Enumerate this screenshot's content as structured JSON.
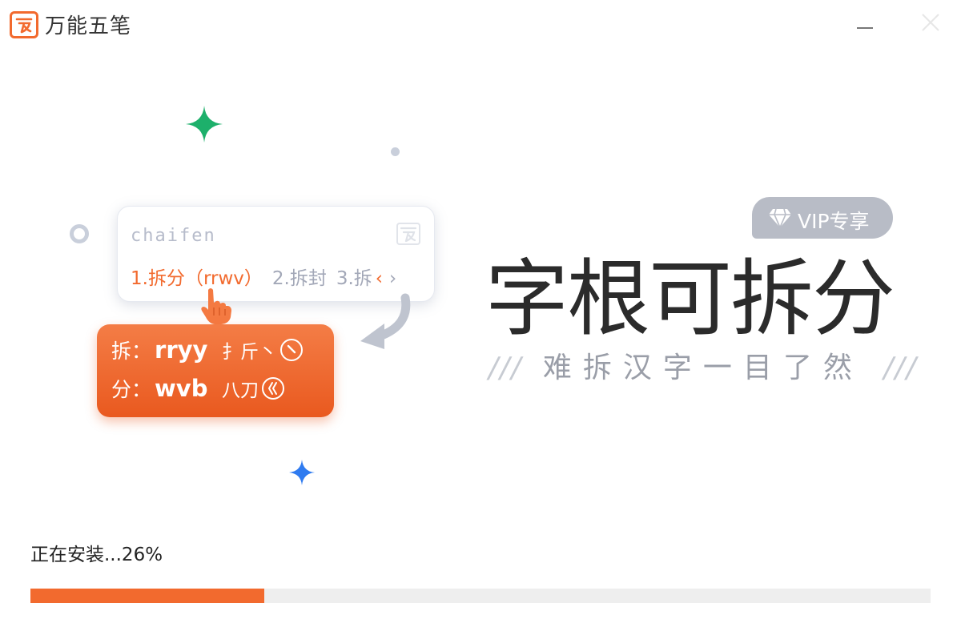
{
  "window": {
    "title": "万能五笔",
    "minimize_label": "—",
    "close_label": "×"
  },
  "candidate": {
    "input_text": "chaifen",
    "first": "1.拆分（rrwv）",
    "second": "2.拆封",
    "third": "3.拆",
    "prev": "‹",
    "next": "›"
  },
  "split_card": {
    "rows": [
      {
        "char": "拆：",
        "code": "rryy",
        "roots": "扌斤丶"
      },
      {
        "char": "分：",
        "code": "wvb",
        "roots": "八刀"
      }
    ]
  },
  "promo": {
    "vip_label": "VIP专享",
    "headline": "字根可拆分",
    "subtitle_slashes_left": "///",
    "subtitle": "难拆汉字一目了然",
    "subtitle_slashes_right": "///"
  },
  "progress": {
    "label": "正在安装...26%",
    "percent": 26,
    "fill_color": "#f26a2e"
  },
  "colors": {
    "brand_orange": "#f26a2e",
    "star_green": "#1db06b",
    "star_blue": "#2f7bf0"
  }
}
